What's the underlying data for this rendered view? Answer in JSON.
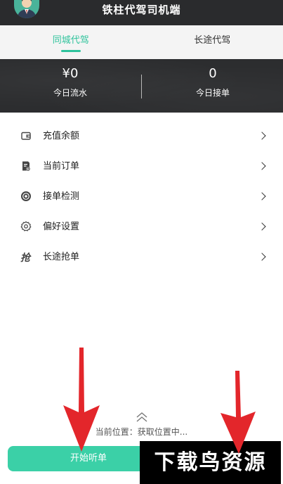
{
  "header": {
    "title": "铁柱代驾司机端",
    "avatar": "driver-avatar"
  },
  "tabs": [
    {
      "label": "同城代驾",
      "active": true
    },
    {
      "label": "长途代驾",
      "active": false
    }
  ],
  "stats": {
    "left": {
      "value": "¥0",
      "label": "今日流水"
    },
    "right": {
      "value": "0",
      "label": "今日接单"
    }
  },
  "menu": [
    {
      "label": "充值余额",
      "icon": "wallet-icon"
    },
    {
      "label": "当前订单",
      "icon": "order-icon"
    },
    {
      "label": "接单检测",
      "icon": "detect-icon"
    },
    {
      "label": "偏好设置",
      "icon": "gear-icon"
    },
    {
      "label": "长途抢单",
      "icon": "grab-icon"
    }
  ],
  "bottom": {
    "location": "当前位置：获取位置中...",
    "start_label": "开始听单"
  },
  "watermark": "下载鸟资源",
  "colors": {
    "accent": "#2fc39c",
    "button": "#3bd0a7",
    "header_bg": "#2a2b2d",
    "arrow": "#e3262b"
  }
}
